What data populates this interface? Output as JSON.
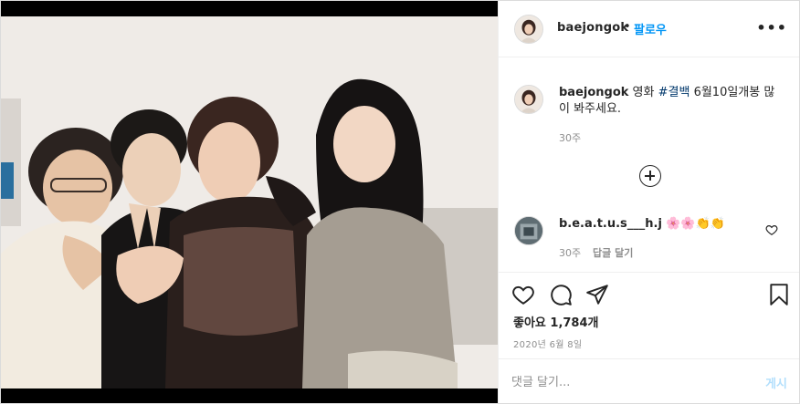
{
  "post": {
    "username": "baejongok",
    "follow_dot": "•",
    "follow_label": "팔로우",
    "more_label": "•••"
  },
  "caption": {
    "username": "baejongok",
    "text_before": " 영화 ",
    "hashtag": "#결백",
    "text_after": " 6월10일개봉 많이 봐주세요.",
    "time": "30주"
  },
  "comment": {
    "username": "b.e.a.t.u.s___h.j",
    "emoji": "🌸🌸👏👏",
    "time": "30주",
    "reply_label": "답글 달기"
  },
  "stats": {
    "likes": "좋아요 1,784개",
    "date": "2020년 6월 8일"
  },
  "composer": {
    "placeholder": "댓글 달기...",
    "post_label": "게시"
  },
  "icons": {
    "like": "heart-icon",
    "comment": "comment-icon",
    "share": "share-icon",
    "save": "bookmark-icon",
    "expand": "plus-circle-icon"
  },
  "colors": {
    "accent": "#0095f6",
    "hashtag": "#00376b",
    "muted": "#8e8e8e",
    "post_disabled": "#b2dffc"
  }
}
